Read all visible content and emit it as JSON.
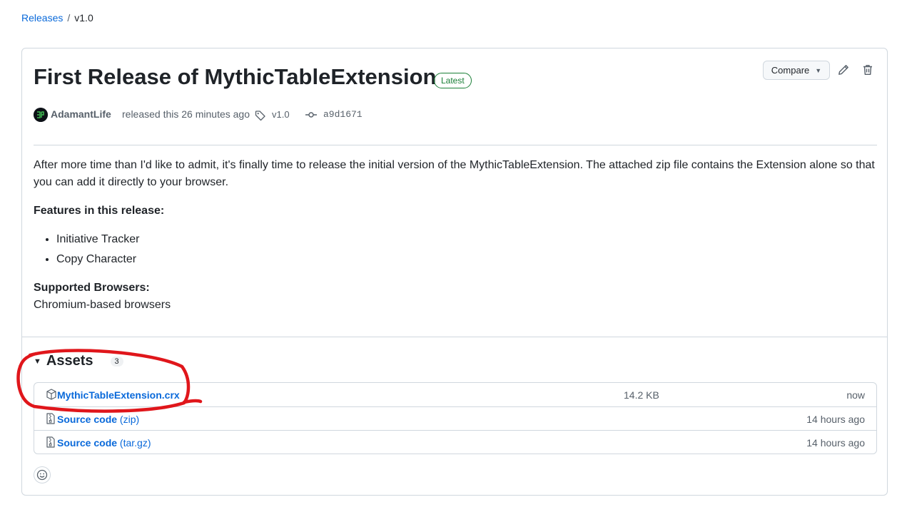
{
  "breadcrumb": {
    "parent": "Releases",
    "separator": "/",
    "current": "v1.0"
  },
  "release": {
    "title": "First Release of MythicTableExtension",
    "badge": "Latest",
    "author": "AdamantLife",
    "released_text": "released this 26 minutes ago",
    "tag": "v1.0",
    "commit": "a9d1671"
  },
  "actions": {
    "compare_label": "Compare",
    "edit_icon": "pencil-icon",
    "delete_icon": "trash-icon"
  },
  "description": {
    "intro": "After more time than I'd like to admit, it's finally time to release the initial version of the MythicTableExtension. The attached zip file contains the Extension alone so that you can add it directly to your browser.",
    "features_heading": "Features in this release:",
    "features": [
      "Initiative Tracker",
      "Copy Character"
    ],
    "browsers_heading": "Supported Browsers:",
    "browsers_text": "Chromium-based browsers"
  },
  "assets": {
    "title": "Assets",
    "count": "3",
    "items": [
      {
        "name": "MythicTableExtension.crx",
        "ext": "",
        "size": "14.2 KB",
        "time": "now",
        "icon": "package-icon"
      },
      {
        "name": "Source code",
        "ext": "(zip)",
        "size": "",
        "time": "14 hours ago",
        "icon": "file-zip-icon"
      },
      {
        "name": "Source code",
        "ext": "(tar.gz)",
        "size": "",
        "time": "14 hours ago",
        "icon": "file-zip-icon"
      }
    ]
  },
  "colors": {
    "accent": "#0969da",
    "latest": "#1a7f37",
    "annotation": "#e0161b"
  }
}
